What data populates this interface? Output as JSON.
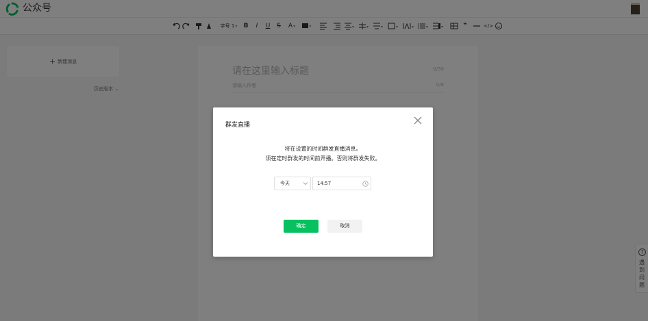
{
  "header": {
    "brand": "公众号"
  },
  "toolbar": {
    "font_size": "字号",
    "font_size_value": "1",
    "font_color": "A"
  },
  "sidebar": {
    "new_message": "新建消息",
    "history": "历史版本"
  },
  "editor": {
    "title_placeholder": "请在这里输入标题",
    "title_count": "0/30",
    "author_placeholder": "请输入作者",
    "author_count": "0/8"
  },
  "help": {
    "label": "遇到问题"
  },
  "dialog": {
    "title": "群发直播",
    "message_line1": "将在设置的时间群发直播消息。",
    "message_line2": "须在定时群发的时间前开播。否则将群发失败。",
    "day_value": "今天",
    "time_value": "14:57",
    "confirm_label": "确定",
    "cancel_label": "取消"
  },
  "colors": {
    "primary": "#07c160",
    "overlay": "rgba(0,0,0,0.5)"
  }
}
